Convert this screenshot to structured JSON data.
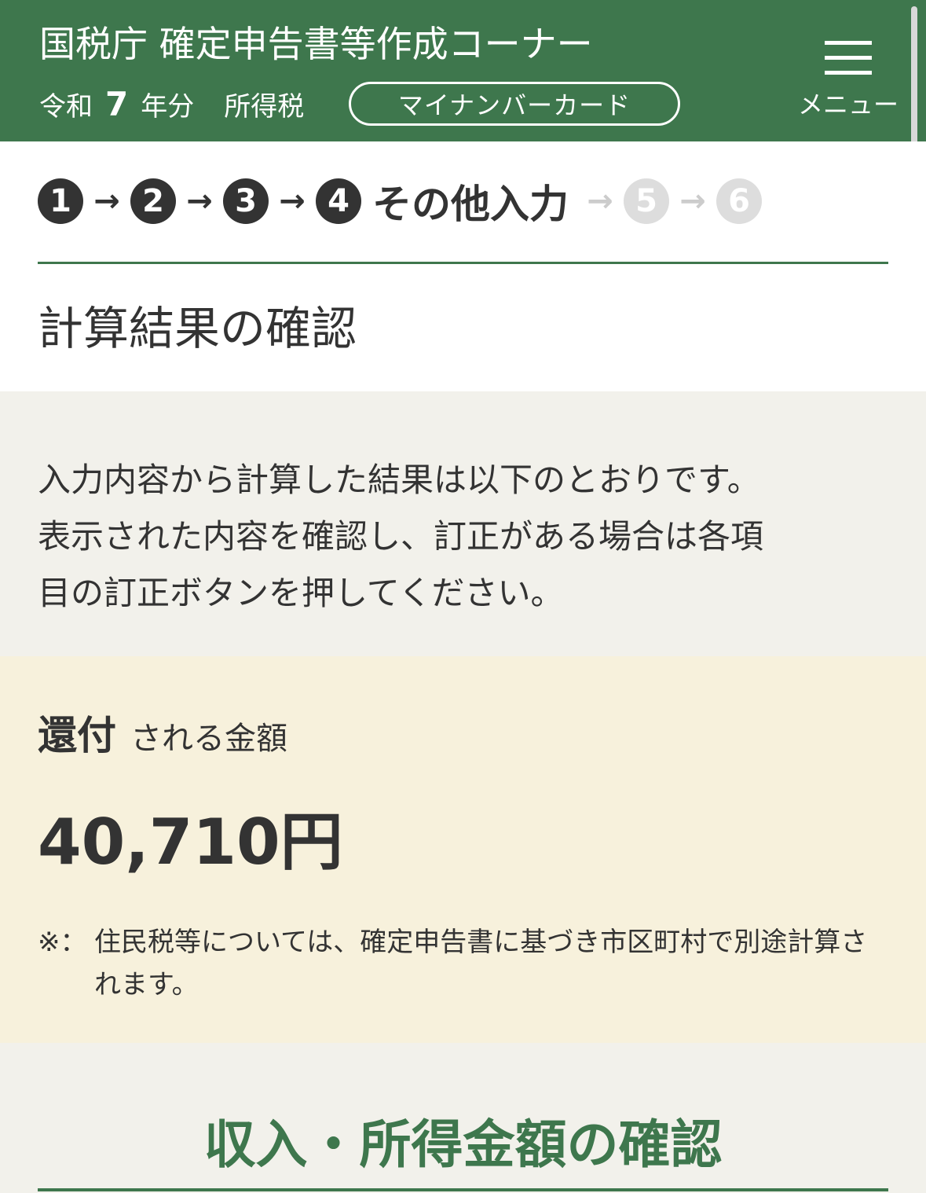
{
  "header": {
    "title": "国税庁 確定申告書等作成コーナー",
    "era": "令和",
    "year": "7",
    "year_unit": "年分",
    "tax_type": "所得税",
    "mynumber_button": "マイナンバーカード",
    "menu_label": "メニュー",
    "background_color": "#3e774d"
  },
  "steps": {
    "items": [
      {
        "number": "1",
        "state": "done"
      },
      {
        "number": "2",
        "state": "done"
      },
      {
        "number": "3",
        "state": "done"
      },
      {
        "number": "4",
        "state": "current",
        "label": "その他入力"
      },
      {
        "number": "5",
        "state": "future"
      },
      {
        "number": "6",
        "state": "future"
      }
    ]
  },
  "page": {
    "heading": "計算結果の確認",
    "intro": "入力内容から計算した結果は以下のとおりです。\n表示された内容を確認し、訂正がある場合は各項\n目の訂正ボタンを押してください。"
  },
  "refund": {
    "label_strong": "還付",
    "label_rest": "される金額",
    "amount": "40,710円",
    "note_mark": "※：",
    "note_text": "住民税等については、確定申告書に基づき市区町村で別途計算されます。",
    "background_color": "#f7f1dc"
  },
  "section": {
    "heading": "収入・所得金額の確認"
  }
}
